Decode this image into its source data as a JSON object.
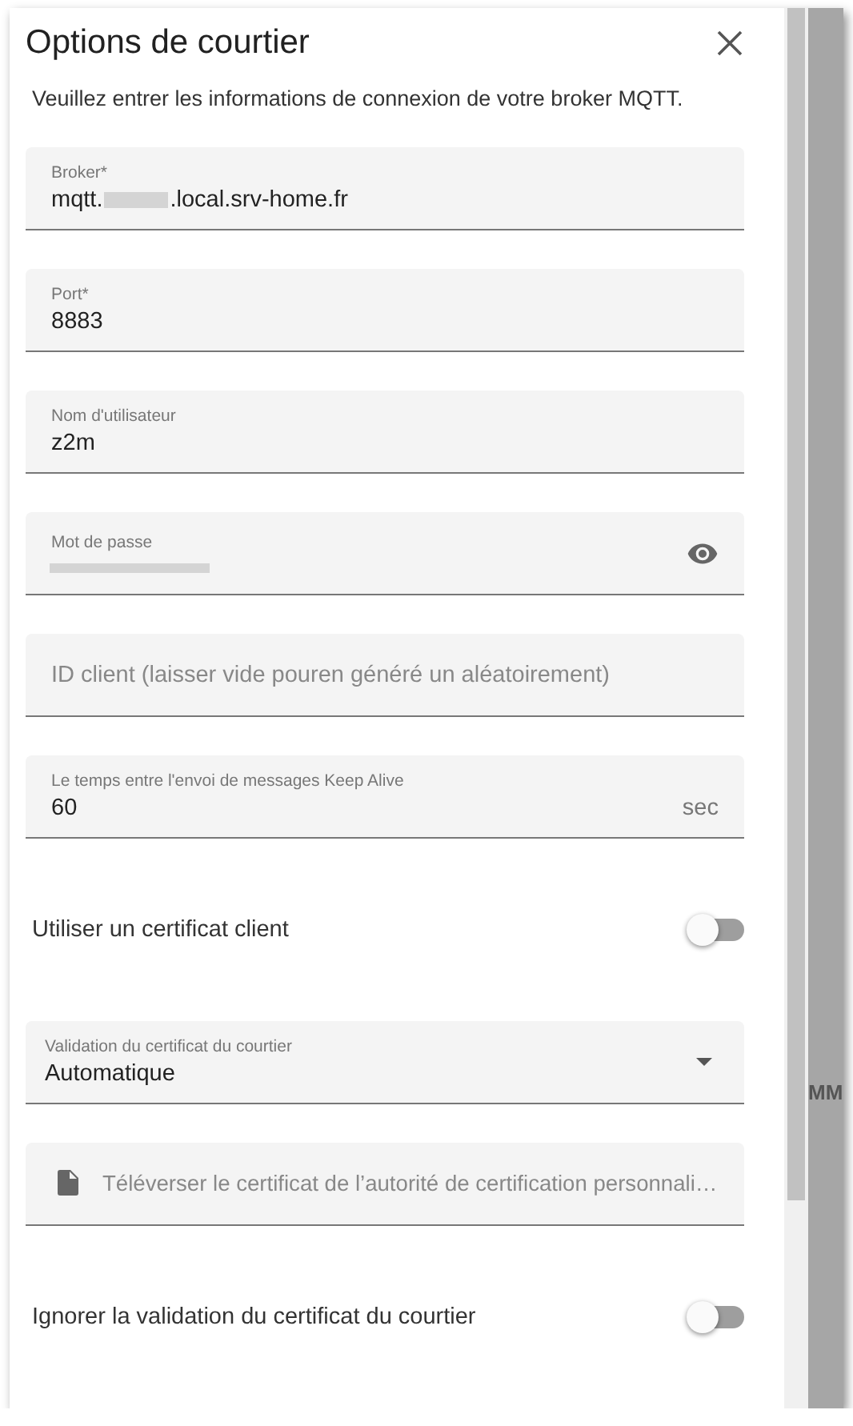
{
  "dialog": {
    "title": "Options de courtier",
    "description": "Veuillez entrer les informations de connexion de votre broker MQTT."
  },
  "fields": [
    {
      "kind": "text",
      "label": "Broker*",
      "value_before": "mqtt.",
      "value_after": ".local.srv-home.fr",
      "redacted": true
    },
    {
      "kind": "text",
      "label": "Port*",
      "value_before": "8883"
    },
    {
      "kind": "text",
      "label": "Nom d'utilisateur",
      "value_before": "z2m"
    },
    {
      "kind": "password",
      "label": "Mot de passe",
      "redacted": true
    },
    {
      "kind": "empty",
      "placeholder": "ID client (laisser vide pouren généré un aléatoirement)"
    },
    {
      "kind": "suffix",
      "label": "Le temps entre l'envoi de messages Keep Alive",
      "value_before": "60",
      "suffix": "sec"
    },
    {
      "kind": "switch",
      "label": "Utiliser un certificat client",
      "on": false
    },
    {
      "kind": "select",
      "label": "Validation du certificat du courtier",
      "value_before": "Automatique"
    },
    {
      "kind": "file",
      "placeholder": "Téléverser le certificat de l’autorité de certification personnali…"
    },
    {
      "kind": "switch",
      "label": "Ignorer la validation du certificat du courtier",
      "on": false
    }
  ],
  "backdrop": {
    "text": "MM"
  }
}
